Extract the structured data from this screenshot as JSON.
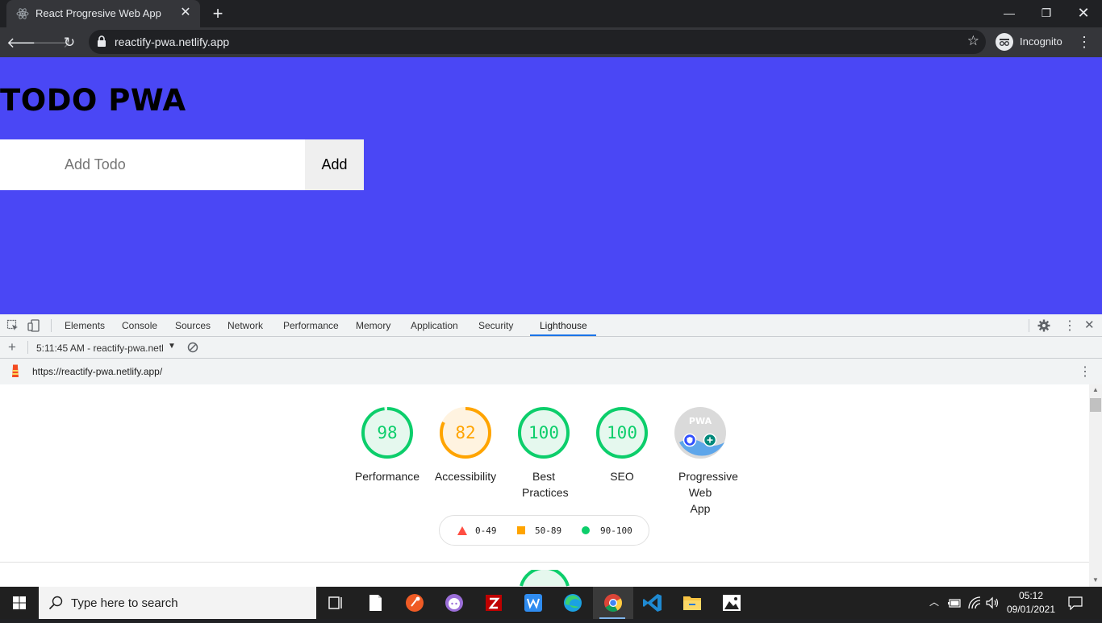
{
  "browser": {
    "tab_title": "React Progresive Web App",
    "url": "reactify-pwa.netlify.app",
    "profile_label": "Incognito"
  },
  "page": {
    "title": "TODO PWA",
    "input_placeholder": "Add Todo",
    "add_label": "Add",
    "background_color": "#4a47f5"
  },
  "devtools": {
    "tabs": [
      "Elements",
      "Console",
      "Sources",
      "Network",
      "Performance",
      "Memory",
      "Application",
      "Security",
      "Lighthouse"
    ],
    "active_tab": "Lighthouse",
    "report_selector": "5:11:45 AM - reactify-pwa.netl",
    "report_url": "https://reactify-pwa.netlify.app/"
  },
  "lighthouse": {
    "scores": [
      {
        "label": "Performance",
        "score": "98",
        "value": 98,
        "color": "#0cce6b"
      },
      {
        "label": "Accessibility",
        "score": "82",
        "value": 82,
        "color": "#ffa400"
      },
      {
        "label": "Best Practices",
        "score": "100",
        "value": 100,
        "color": "#0cce6b"
      },
      {
        "label": "SEO",
        "score": "100",
        "value": 100,
        "color": "#0cce6b"
      },
      {
        "label": "Progressive Web App",
        "score": "",
        "value": null,
        "color": "#cccccc"
      }
    ],
    "pwa_badge_text": "PWA",
    "legend": [
      "0-49",
      "50-89",
      "90-100"
    ]
  },
  "taskbar": {
    "search_placeholder": "Type here to search",
    "time": "05:12",
    "date": "09/01/2021"
  }
}
